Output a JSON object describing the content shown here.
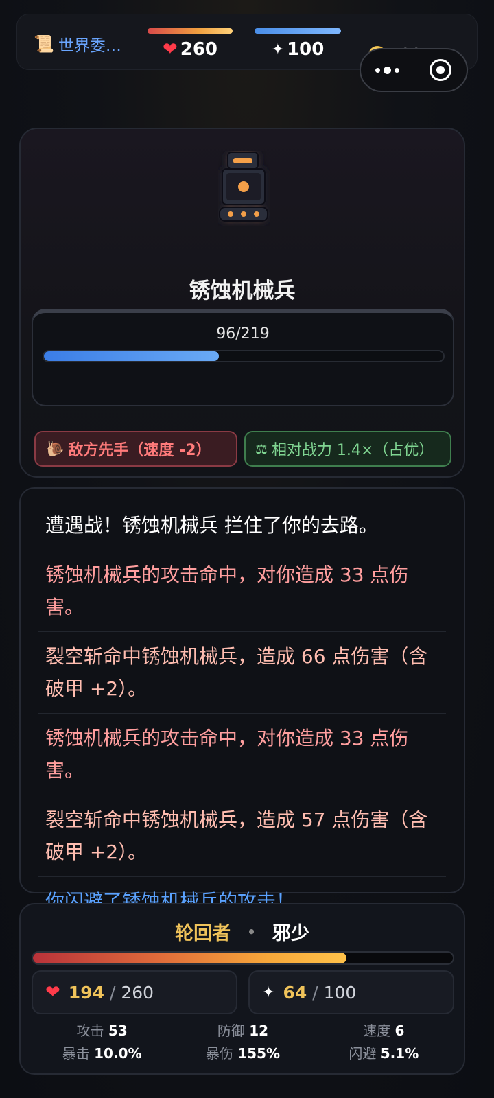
{
  "topbar": {
    "quest_icon": "scroll-icon",
    "quest_label": "世界委…",
    "hp_value": "260",
    "mp_value": "100",
    "gold_value": "500"
  },
  "capsule": {
    "more_icon": "more-dots-icon",
    "close_icon": "target-close-icon"
  },
  "enemy": {
    "icon": "robot-icon",
    "name": "锈蚀机械兵",
    "hp_text": "96/219",
    "hp_fraction": 0.438,
    "tag_first": "敌方先手（速度 -2）",
    "tag_power": "相对战力 1.4×（占优）"
  },
  "log": [
    {
      "type": "info",
      "text": "遭遇战！锈蚀机械兵 拦住了你的去路。"
    },
    {
      "type": "enemy",
      "text": "锈蚀机械兵的攻击命中，对你造成 33 点伤害。"
    },
    {
      "type": "player",
      "text": "裂空斩命中锈蚀机械兵，造成 66 点伤害（含破甲 +2）。"
    },
    {
      "type": "enemy",
      "text": "锈蚀机械兵的攻击命中，对你造成 33 点伤害。"
    },
    {
      "type": "player",
      "text": "裂空斩命中锈蚀机械兵，造成 57 点伤害（含破甲 +2）。"
    },
    {
      "type": "dodge",
      "text": "你闪避了锈蚀机械兵的攻击！"
    }
  ],
  "player": {
    "class": "轮回者",
    "separator": "•",
    "name": "邪少",
    "hp_fraction": 0.746,
    "hp_current": "194",
    "hp_max": "260",
    "mp_current": "64",
    "mp_max": "100",
    "stats": [
      {
        "label": "攻击",
        "value": "53"
      },
      {
        "label": "防御",
        "value": "12"
      },
      {
        "label": "速度",
        "value": "6"
      },
      {
        "label": "暴击",
        "value": "10.0%"
      },
      {
        "label": "暴伤",
        "value": "155%"
      },
      {
        "label": "闪避",
        "value": "5.1%"
      }
    ]
  },
  "colors": {
    "accent_blue": "#5aa2ff",
    "gold": "#f0c35a",
    "danger": "#ff7b7b",
    "good": "#7fd491"
  }
}
